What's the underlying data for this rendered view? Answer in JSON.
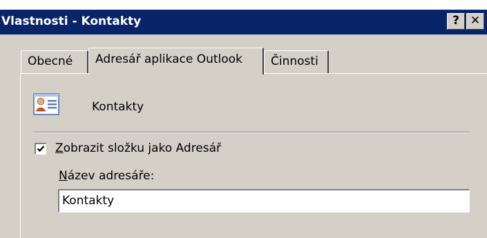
{
  "window": {
    "title": "Vlastnosti - Kontakty",
    "help_label": "?",
    "close_label": "✕"
  },
  "tabs": [
    {
      "label": "Obecné",
      "selected": false
    },
    {
      "label": "Adresář aplikace Outlook",
      "selected": true
    },
    {
      "label": "Činnosti",
      "selected": false
    }
  ],
  "folder": {
    "icon": "contact-card-icon",
    "name": "Kontakty"
  },
  "show_as_addressbook": {
    "checked": true,
    "label_hotkey": "Z",
    "label_rest": "obrazit složku jako Adresář"
  },
  "addressbook_name": {
    "label_hotkey": "N",
    "label_rest": "ázev adresáře:",
    "value": "Kontakty"
  }
}
